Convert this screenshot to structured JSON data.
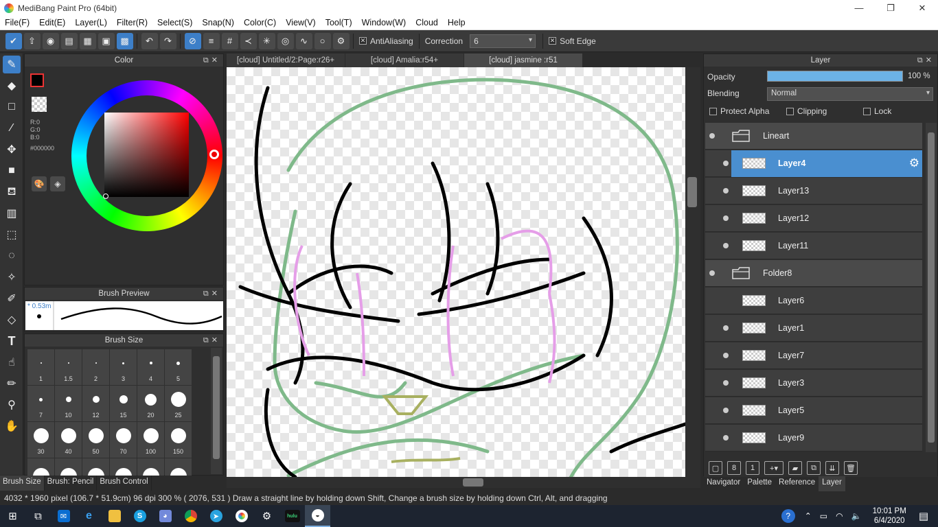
{
  "window": {
    "title": "MediBang Paint Pro (64bit)",
    "min": "—",
    "max": "❐",
    "close": "✕"
  },
  "menu": [
    "File(F)",
    "Edit(E)",
    "Layer(L)",
    "Filter(R)",
    "Select(S)",
    "Snap(N)",
    "Color(C)",
    "View(V)",
    "Tool(T)",
    "Window(W)",
    "Cloud",
    "Help"
  ],
  "toolbar": {
    "antialiasing_label": "AntiAliasing",
    "correction_label": "Correction",
    "correction_value": "6",
    "soft_edge_label": "Soft Edge",
    "check_mark": "✕"
  },
  "color_panel": {
    "title": "Color",
    "r": "R:0",
    "g": "G:0",
    "b": "B:0",
    "hex": "#000000",
    "primary": "#000000",
    "secondary": "#440000"
  },
  "brush_preview": {
    "title": "Brush Preview",
    "size_label": "* 0.53m"
  },
  "brush_size": {
    "title": "Brush Size",
    "sizes": [
      "1",
      "1.5",
      "2",
      "3",
      "4",
      "5",
      "7",
      "10",
      "12",
      "15",
      "20",
      "25",
      "30",
      "40",
      "50",
      "70",
      "100",
      "150"
    ]
  },
  "brush_tabs": [
    "Brush Size",
    "Brush: Pencil",
    "Brush Control"
  ],
  "doc_tabs": [
    "[cloud] Untitled/2:Page:r26+",
    "[cloud] Amalia:r54+",
    "[cloud] jasmine :r51"
  ],
  "layer_panel": {
    "title": "Layer",
    "opacity_label": "Opacity",
    "opacity_value": "100 %",
    "opacity_fraction": 1.0,
    "blending_label": "Blending",
    "blending_value": "Normal",
    "protect_alpha": "Protect Alpha",
    "clipping": "Clipping",
    "lock": "Lock",
    "layers": [
      {
        "name": "Lineart",
        "type": "folder",
        "visible": true
      },
      {
        "name": "Layer4",
        "type": "layer",
        "visible": true,
        "selected": true
      },
      {
        "name": "Layer13",
        "type": "layer",
        "visible": true
      },
      {
        "name": "Layer12",
        "type": "layer",
        "visible": true
      },
      {
        "name": "Layer11",
        "type": "layer",
        "visible": true
      },
      {
        "name": "Folder8",
        "type": "folder",
        "visible": true
      },
      {
        "name": "Layer6",
        "type": "layer",
        "visible": false
      },
      {
        "name": "Layer1",
        "type": "layer",
        "visible": true
      },
      {
        "name": "Layer7",
        "type": "layer",
        "visible": true
      },
      {
        "name": "Layer3",
        "type": "layer",
        "visible": true
      },
      {
        "name": "Layer5",
        "type": "layer",
        "visible": true
      },
      {
        "name": "Layer9",
        "type": "layer",
        "visible": true
      }
    ]
  },
  "right_tabs": [
    "Navigator",
    "Palette",
    "Reference",
    "Layer"
  ],
  "status": "4032 * 1960 pixel   (106.7 * 51.9cm)   96 dpi   300 %   ( 2076, 531 )   Draw a straight line by holding down Shift, Change a brush size by holding down Ctrl, Alt, and dragging",
  "taskbar": {
    "time": "10:01 PM",
    "date": "6/4/2020",
    "hulu": "hulu"
  },
  "colors": {
    "accent": "#3d7fc8",
    "selected_layer": "#4a8fd0",
    "panel": "#2f2f2f"
  }
}
